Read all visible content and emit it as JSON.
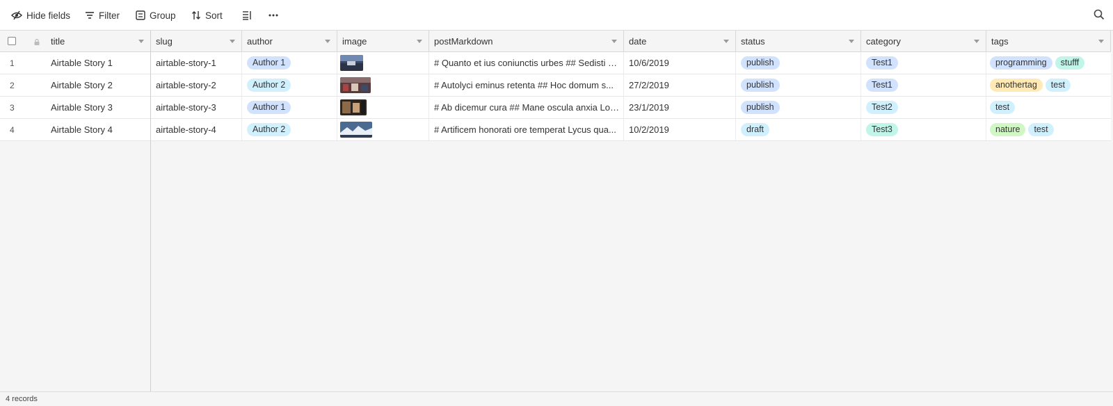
{
  "toolbar": {
    "hide_fields": "Hide fields",
    "filter": "Filter",
    "group": "Group",
    "sort": "Sort"
  },
  "columns": [
    "title",
    "slug",
    "author",
    "image",
    "postMarkdown",
    "date",
    "status",
    "category",
    "tags"
  ],
  "rows": [
    {
      "num": "1",
      "title": "Airtable Story 1",
      "slug": "airtable-story-1",
      "author": "Author 1",
      "post": "# Quanto et ius coniunctis urbes ## Sedisti c...",
      "date": "10/6/2019",
      "status": "publish",
      "category": "Test1",
      "tags": [
        "programming",
        "stufff"
      ]
    },
    {
      "num": "2",
      "title": "Airtable Story 2",
      "slug": "airtable-story-2",
      "author": "Author 2",
      "post": "# Autolyci eminus retenta ## Hoc domum s...",
      "date": "27/2/2019",
      "status": "publish",
      "category": "Test1",
      "tags": [
        "anothertag",
        "test"
      ]
    },
    {
      "num": "3",
      "title": "Airtable Story 3",
      "slug": "airtable-story-3",
      "author": "Author 1",
      "post": "# Ab dicemur cura ## Mane oscula anxia Lor...",
      "date": "23/1/2019",
      "status": "publish",
      "category": "Test2",
      "tags": [
        "test"
      ]
    },
    {
      "num": "4",
      "title": "Airtable Story 4",
      "slug": "airtable-story-4",
      "author": "Author 2",
      "post": "# Artificem honorati ore temperat Lycus qua...",
      "date": "10/2/2019",
      "status": "draft",
      "category": "Test3",
      "tags": [
        "nature",
        "test"
      ]
    }
  ],
  "colors": {
    "author_1": "#d1e2ff",
    "author_2": "#d0f0fd",
    "publish": "#d1e2ff",
    "draft": "#d0f0fd",
    "Test1": "#d1e2ff",
    "Test2": "#d0f0fd",
    "Test3": "#c2f5e9",
    "programming": "#d1e2ff",
    "stufff": "#c2f5e9",
    "anothertag": "#ffeab6",
    "test": "#d0f0fd",
    "nature": "#d1f7c4"
  },
  "footer": {
    "records": "4 records"
  }
}
